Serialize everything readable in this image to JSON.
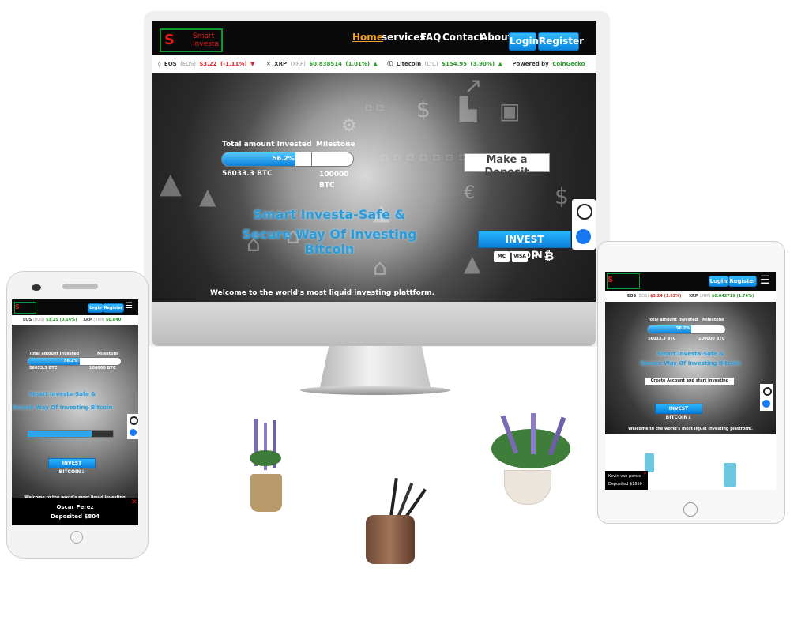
{
  "brand": {
    "name": "Smart Investa",
    "logo_mark": "S"
  },
  "nav": {
    "items": [
      "Home",
      "services",
      "FAQ",
      "Contact",
      "About"
    ],
    "active": "Home",
    "login": "Login",
    "register": "Register"
  },
  "ticker": {
    "items": [
      {
        "name": "EOS",
        "symbol": "(EOS)",
        "price": "$3.22",
        "change": "(-1.11%)",
        "dir": "down"
      },
      {
        "name": "XRP",
        "symbol": "(XRP)",
        "price": "$0.838514",
        "change": "(1.01%)",
        "dir": "up"
      },
      {
        "name": "Litecoin",
        "symbol": "(LTC)",
        "price": "$154.95",
        "change": "(3.90%)",
        "dir": "up"
      }
    ],
    "powered_by": "Powered by",
    "powered_brand": "CoinGecko"
  },
  "hero": {
    "total_label": "Total amount Invested",
    "milestone_label": "Milestone",
    "progress_percent": 56.2,
    "progress_text": "56.2%",
    "invested_value": "56033.3 BTC",
    "milestone_value": "100000",
    "milestone_unit": "BTC",
    "headline_1": "Smart Investa-Safe &",
    "headline_2": "Secure Way Of Investing Bitcoin",
    "deposit_button": "Make a Deposit",
    "invest_button": "INVEST BITCOIN↓",
    "payment_methods": [
      "MC",
      "VISA",
      "P",
      "₿"
    ],
    "welcome": "Welcome to the world's most liquid investing plattform."
  },
  "phone": {
    "nav_login": "Login",
    "nav_register": "Register",
    "ticker": [
      {
        "name": "EOS",
        "symbol": "(EOS)",
        "price": "$3.25",
        "change": "(0.14%)",
        "dir": "up"
      },
      {
        "name": "XRP",
        "symbol": "(XRP)",
        "price": "$0.840",
        "change": "",
        "dir": "up"
      }
    ],
    "total_label": "Total amount Invested",
    "milestone_label": "Milestone",
    "progress_text": "56.2%",
    "invested_value": "56033.3 BTC",
    "milestone_value": "100000 BTC",
    "headline_1": "Smart Investa-Safe &",
    "headline_2": "Secure Way Of Investing Bitcoin",
    "invest_button": "INVEST BITCOIN↓",
    "welcome": "Welcome to the world's most liquid investing",
    "popup_name": "Oscar Perez",
    "popup_text": "Deposited $804"
  },
  "tablet": {
    "nav_login": "Login",
    "nav_register": "Register",
    "ticker": [
      {
        "name": "EOS",
        "symbol": "(EOS)",
        "price": "$3.24",
        "change": "(1.53%)",
        "dir": "down"
      },
      {
        "name": "XRP",
        "symbol": "(XRP)",
        "price": "$0.842719",
        "change": "(1.76%)",
        "dir": "up"
      }
    ],
    "total_label": "Total amount Invested",
    "milestone_label": "Milestone",
    "progress_text": "56.2%",
    "invested_value": "56033.3 BTC",
    "milestone_value": "100000 BTC",
    "headline_1": "Smart Investa-Safe &",
    "headline_2": "Secure Way Of Investing Bitcoin",
    "create_account": "Create Account and start investing",
    "invest_button": "INVEST BITCOIN↓",
    "welcome": "Welcome to the world's most liquid investing plattform.",
    "popup_name": "Kevin van persie",
    "popup_text": "Deposited $1650"
  },
  "colors": {
    "accent": "#0a86e0",
    "brand_red": "#e41b1b",
    "brand_green": "#0b9a2d",
    "active_nav": "#f5a623"
  }
}
